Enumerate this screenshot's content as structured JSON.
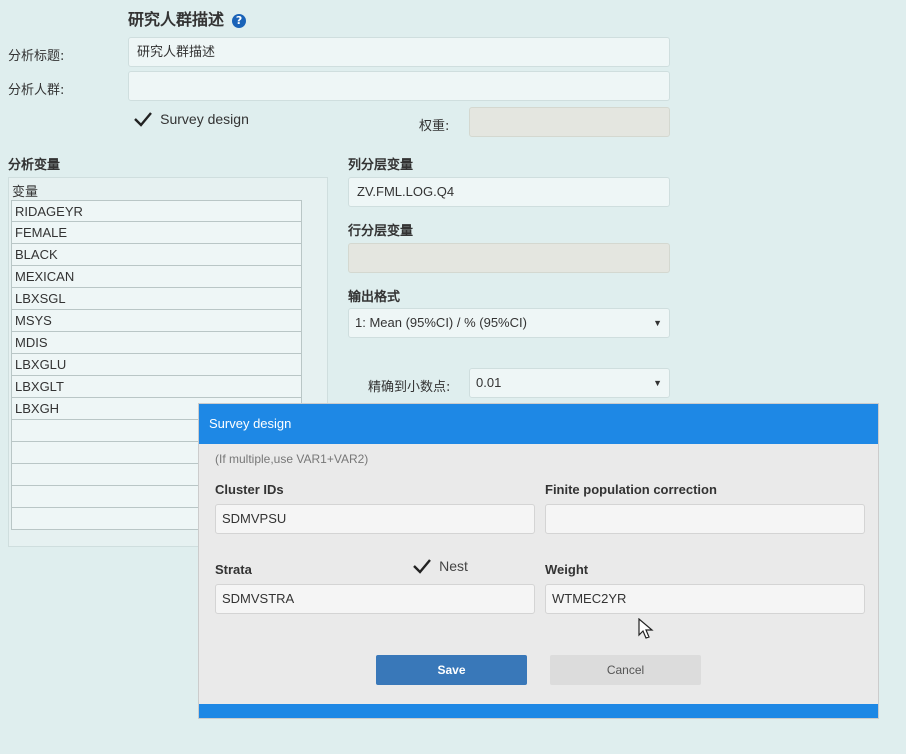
{
  "header": {
    "title": "研究人群描述",
    "help_icon": "?"
  },
  "form": {
    "analysis_title_label": "分析标题:",
    "analysis_title_value": "研究人群描述",
    "analysis_population_label": "分析人群:",
    "analysis_population_value": "",
    "survey_design_checkbox_label": "Survey design",
    "survey_design_checked": true,
    "weight_label": "权重:",
    "weight_value": ""
  },
  "variables": {
    "section_title": "分析变量",
    "column_header": "变量",
    "items": [
      "RIDAGEYR",
      "FEMALE",
      "BLACK",
      "MEXICAN",
      "LBXSGL",
      "MSYS",
      "MDIS",
      "LBXGLU",
      "LBXGLT",
      "LBXGH",
      "",
      "",
      "",
      "",
      ""
    ]
  },
  "right": {
    "col_strat_title": "列分层变量",
    "col_strat_value": "ZV.FML.LOG.Q4",
    "row_strat_title": "行分层变量",
    "row_strat_value": "",
    "output_format_title": "输出格式",
    "output_format_selected": "1: Mean (95%CI) / % (95%CI)",
    "precision_label": "精确到小数点:",
    "precision_selected": "0.01"
  },
  "modal": {
    "title": "Survey design",
    "hint": "(If multiple,use VAR1+VAR2)",
    "cluster_ids_label": "Cluster IDs",
    "cluster_ids_value": "SDMVPSU",
    "fpc_label": "Finite population correction",
    "fpc_value": "",
    "strata_label": "Strata",
    "strata_value": "SDMVSTRA",
    "nest_label": "Nest",
    "nest_checked": true,
    "weight_label": "Weight",
    "weight_value": "WTMEC2YR",
    "save_label": "Save",
    "cancel_label": "Cancel"
  },
  "colors": {
    "accent": "#1e88e5",
    "save_button": "#3978b9",
    "background": "#dfeeee"
  },
  "icons": {
    "help": "question-circle-icon",
    "checkbox_check": "check-icon",
    "dropdown": "caret-down-icon",
    "cursor": "mouse-pointer-icon"
  }
}
